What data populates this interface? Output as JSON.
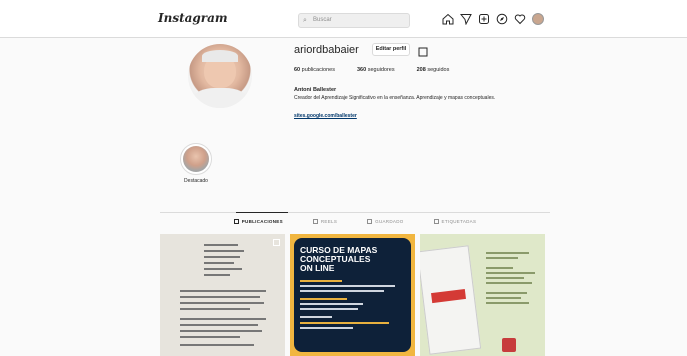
{
  "topbar": {
    "logo": "Instagram",
    "search_placeholder": "Buscar"
  },
  "profile": {
    "username": "ariordbabaier",
    "edit_label": "Editar perfil",
    "stats": [
      {
        "count": "60",
        "label": "publicaciones"
      },
      {
        "count": "360",
        "label": "seguidores"
      },
      {
        "count": "208",
        "label": "seguidos"
      }
    ],
    "full_name": "Antoni Ballester",
    "bio": "Creador del Aprendizaje Significativo en la enseñanza. Aprendizaje y mapas conceptuales.",
    "link": "sites.google.com/ballester"
  },
  "highlight": {
    "label": "Destacado"
  },
  "tabs": [
    {
      "label": "PUBLICACIONES",
      "active": true
    },
    {
      "label": "REELS",
      "active": false
    },
    {
      "label": "GUARDADO",
      "active": false
    },
    {
      "label": "ETIQUETADAS",
      "active": false
    }
  ],
  "posts": {
    "post2_title": "CURSO DE MAPAS\nCONCEPTUALES\nON LINE"
  }
}
